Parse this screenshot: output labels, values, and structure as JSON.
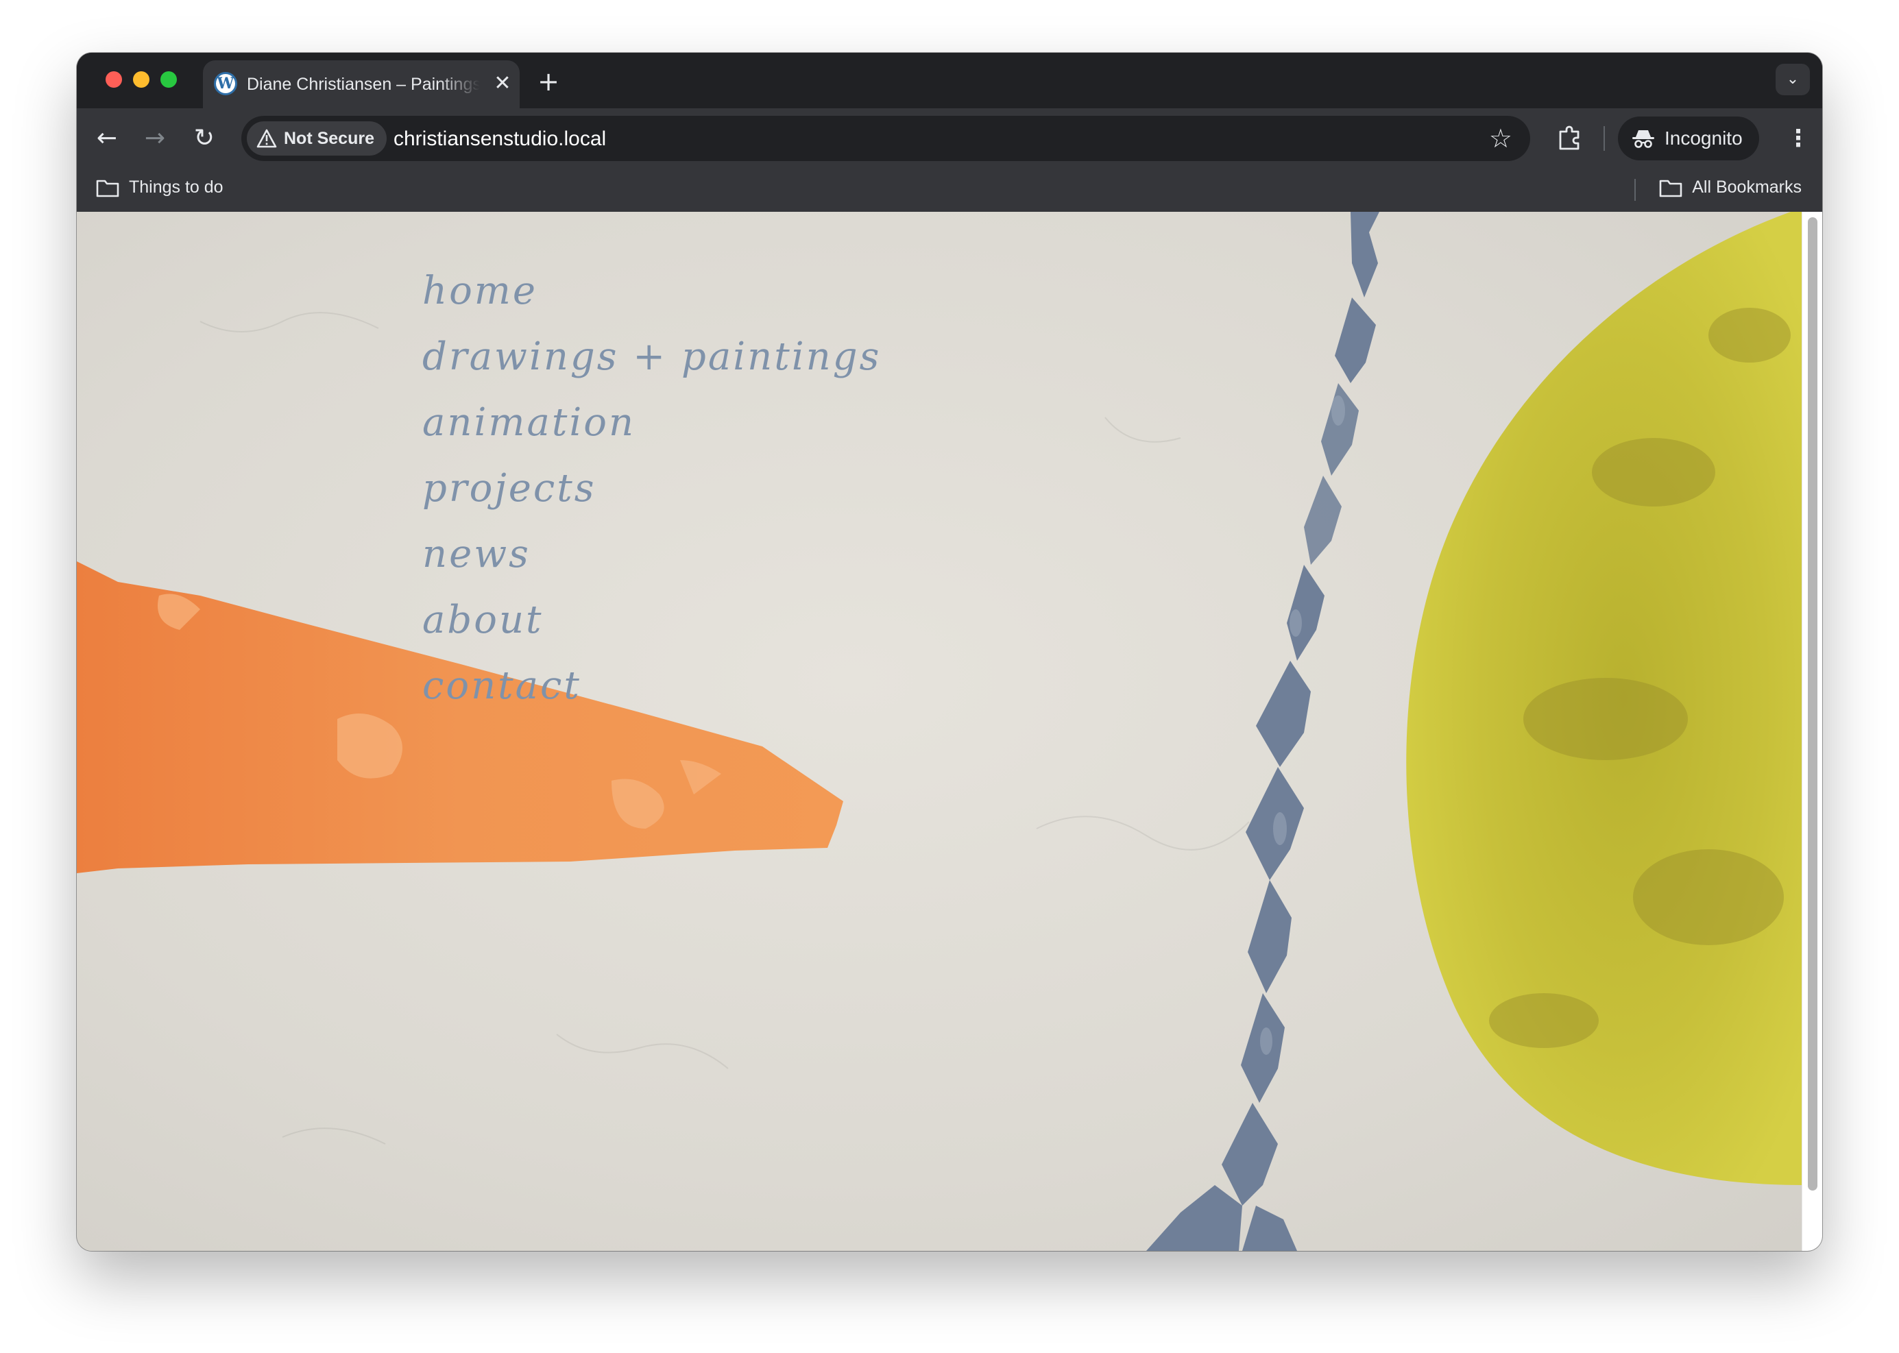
{
  "browser": {
    "tab": {
      "title": "Diane Christiansen – Paintings",
      "favicon": "wordpress-icon",
      "close_icon": "close-icon"
    },
    "new_tab_icon": "plus-icon",
    "tab_search_icon": "chevron-down-icon",
    "toolbar": {
      "back_icon": "arrow-left-icon",
      "forward_icon": "arrow-right-icon",
      "reload_icon": "reload-icon",
      "security_label": "Not Secure",
      "url": "christiansenstudio.local",
      "bookmark_star_icon": "star-icon",
      "extensions_icon": "puzzle-icon",
      "profile_label": "Incognito",
      "menu_icon": "kebab-menu-icon"
    },
    "bookmarks_bar": {
      "left_folder": "Things to do",
      "right_folder": "All Bookmarks"
    }
  },
  "page": {
    "nav": [
      {
        "label": "home"
      },
      {
        "label": "drawings + paintings"
      },
      {
        "label": "animation"
      },
      {
        "label": "projects"
      },
      {
        "label": "news"
      },
      {
        "label": "about"
      },
      {
        "label": "contact"
      }
    ],
    "colors": {
      "nav_text": "#7f92aa",
      "background_paper": "#e4e1da",
      "orange_shape": "#ef8d4d",
      "blue_chain": "#6f7f98",
      "yellow_disc": "#c9c23a"
    }
  }
}
